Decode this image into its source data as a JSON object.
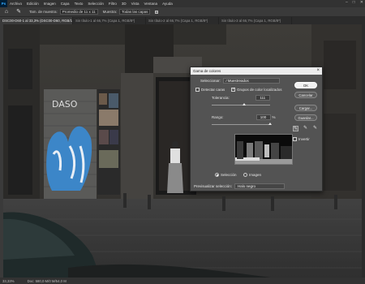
{
  "menubar": {
    "logo": "Ps",
    "items": [
      "Archivo",
      "Edición",
      "Imagen",
      "Capa",
      "Texto",
      "Selección",
      "Filtro",
      "3D",
      "Vista",
      "Ventana",
      "Ayuda"
    ]
  },
  "options": {
    "tam_label": "Tam. de muestra:",
    "tam_value": "Promedio de 11 x 11",
    "muestra_label": "Muestra:",
    "muestra_value": "Todas las capas"
  },
  "tabs": [
    {
      "label": "DSC00-D60-1 al 33,3% (DSC00-D60, RGB/16) *",
      "active": true
    },
    {
      "label": "Sin título-1 al 66,7% (Capa 1, RGB/8*)",
      "active": false
    },
    {
      "label": "Sin título-2 al 66,7% (Capa 1, RGB/8*)",
      "active": false
    },
    {
      "label": "Sin título-3 al 66,7% (Capa 1, RGB/8*)",
      "active": false
    }
  ],
  "status": {
    "zoom": "33,33%",
    "doc": "Doc: 580,0 M/0 M/54,0 M"
  },
  "dialog": {
    "title": "Gama de colores",
    "select_label": "Seleccionar:",
    "select_value": "Muestreados",
    "detect_faces": "Detectar caras",
    "localized": "Grupos de color localizados",
    "tolerance_label": "Tolerancia:",
    "tolerance_value": "111",
    "tolerance_fraction": 0.55,
    "range_label": "Rango:",
    "range_value": "100",
    "range_unit": "%",
    "range_fraction": 1.0,
    "radio_selection": "Selección",
    "radio_image": "Imagen",
    "preview_label": "Previsualizar selección:",
    "preview_value": "Halo negro",
    "ok": "OK",
    "cancel": "Cancelar",
    "load": "Cargar...",
    "save": "Guardar...",
    "invert": "Invertir"
  },
  "colors": {
    "accent_blue": "#31a8ff",
    "dialog_bg": "#535353"
  }
}
